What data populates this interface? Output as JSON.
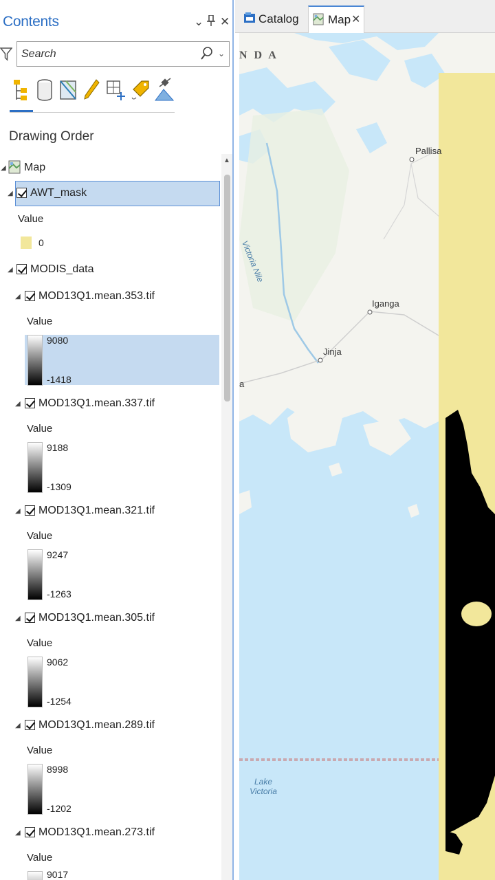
{
  "pane": {
    "title": "Contents",
    "controls": {
      "dropdown": "⌄",
      "pin": "⊥",
      "close": "✕"
    },
    "search_placeholder": "Search",
    "section_title": "Drawing Order"
  },
  "toolbar": {
    "icons": [
      "list-by-drawing-order-icon",
      "list-by-data-source-icon",
      "list-by-selection-icon",
      "list-by-editing-icon",
      "list-by-snapping-icon",
      "list-by-labeling-icon",
      "list-by-perspective-imagery-icon"
    ]
  },
  "tree": {
    "map_label": "Map",
    "mask": {
      "name": "AWT_mask",
      "value_header": "Value",
      "value": "0",
      "swatch_color": "#f2e79b"
    },
    "group": {
      "name": "MODIS_data"
    },
    "layers": [
      {
        "name": "MOD13Q1.mean.353.tif",
        "value_header": "Value",
        "max": "9080",
        "min": "-1418",
        "selected": true
      },
      {
        "name": "MOD13Q1.mean.337.tif",
        "value_header": "Value",
        "max": "9188",
        "min": "-1309"
      },
      {
        "name": "MOD13Q1.mean.321.tif",
        "value_header": "Value",
        "max": "9247",
        "min": "-1263"
      },
      {
        "name": "MOD13Q1.mean.305.tif",
        "value_header": "Value",
        "max": "9062",
        "min": "-1254"
      },
      {
        "name": "MOD13Q1.mean.289.tif",
        "value_header": "Value",
        "max": "8998",
        "min": "-1202"
      },
      {
        "name": "MOD13Q1.mean.273.tif",
        "value_header": "Value",
        "max": "9017",
        "min": ""
      }
    ]
  },
  "tabs": [
    {
      "label": "Catalog",
      "icon": "catalog-icon"
    },
    {
      "label": "Map",
      "icon": "map-icon",
      "active": true,
      "close": "✕"
    }
  ],
  "map": {
    "labels": {
      "country_fragment": "N D A",
      "pallisa": "Pallisa",
      "river": "Victoria Nile",
      "iganga": "Iganga",
      "jinja": "Jinja",
      "edge_a": "a",
      "lake": "Lake Victoria"
    },
    "colors": {
      "water": "#c8e7f9",
      "land": "#f4f4ef",
      "mask": "#f2e79b",
      "data": "#000000"
    }
  }
}
